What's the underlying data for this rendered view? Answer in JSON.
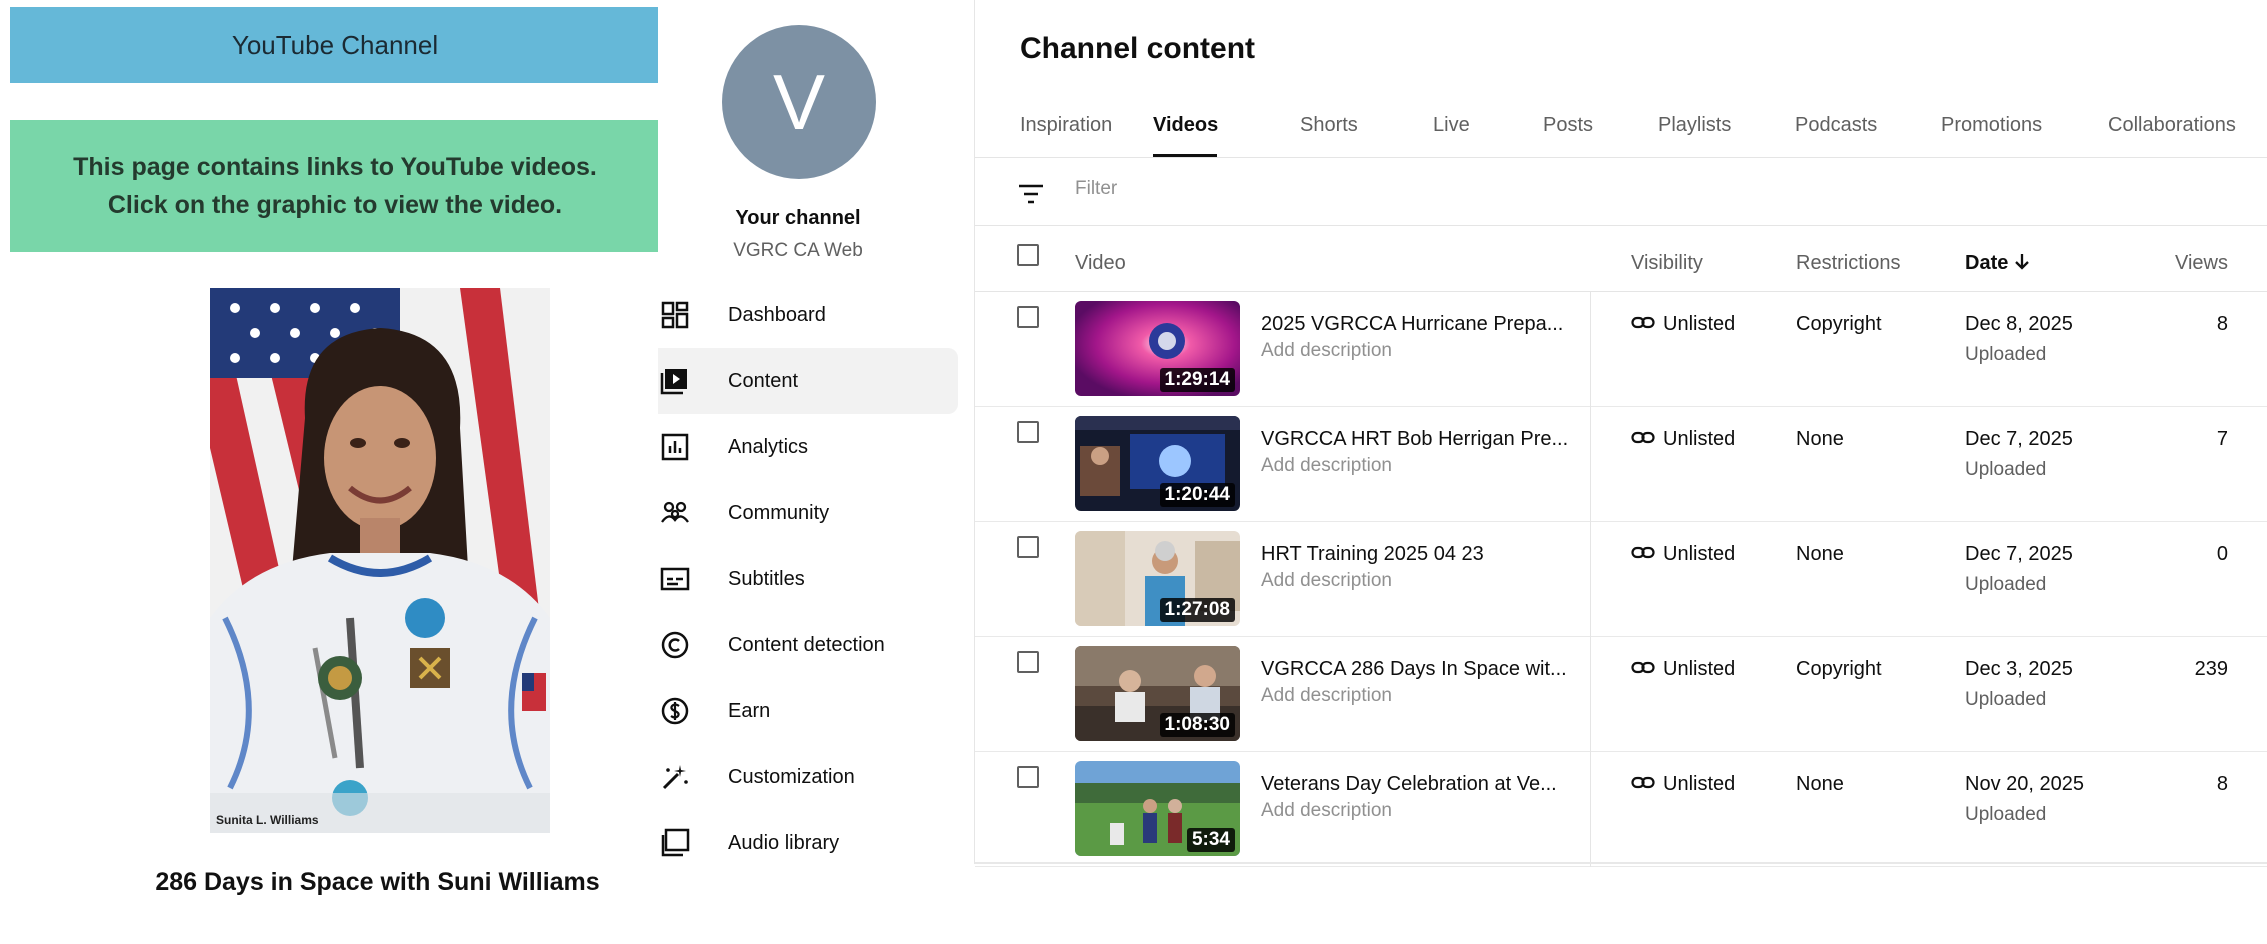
{
  "webpage": {
    "banner_title": "YouTube Channel",
    "notice_line1": "This page contains links to YouTube videos.",
    "notice_line2": "Click on the graphic to view the video.",
    "photo_caption": "Sunita L. Williams",
    "video_title": "286 Days in Space with Suni Williams"
  },
  "studio": {
    "channel": {
      "avatar_letter": "V",
      "label": "Your channel",
      "handle": "VGRC CA Web"
    },
    "nav": [
      {
        "label": "Dashboard",
        "icon": "dashboard-icon",
        "active": false
      },
      {
        "label": "Content",
        "icon": "content-icon",
        "active": true
      },
      {
        "label": "Analytics",
        "icon": "analytics-icon",
        "active": false
      },
      {
        "label": "Community",
        "icon": "community-icon",
        "active": false
      },
      {
        "label": "Subtitles",
        "icon": "subtitles-icon",
        "active": false
      },
      {
        "label": "Content detection",
        "icon": "copyright-icon",
        "active": false
      },
      {
        "label": "Earn",
        "icon": "dollar-icon",
        "active": false
      },
      {
        "label": "Customization",
        "icon": "magic-wand-icon",
        "active": false
      },
      {
        "label": "Audio library",
        "icon": "audio-library-icon",
        "active": false
      }
    ],
    "page_title": "Channel content",
    "tabs": [
      {
        "label": "Inspiration",
        "active": false
      },
      {
        "label": "Videos",
        "active": true
      },
      {
        "label": "Shorts",
        "active": false
      },
      {
        "label": "Live",
        "active": false
      },
      {
        "label": "Posts",
        "active": false
      },
      {
        "label": "Playlists",
        "active": false
      },
      {
        "label": "Podcasts",
        "active": false
      },
      {
        "label": "Promotions",
        "active": false
      },
      {
        "label": "Collaborations",
        "active": false
      }
    ],
    "filter": {
      "placeholder": "Filter",
      "icon": "filter-icon"
    },
    "columns": {
      "video": "Video",
      "visibility": "Visibility",
      "restrictions": "Restrictions",
      "date": "Date",
      "date_sort_icon": "arrow-down-icon",
      "views": "Views"
    },
    "videos": [
      {
        "title": "2025 VGRCCA Hurricane Prepa...",
        "description": "Add description",
        "duration": "1:29:14",
        "visibility": "Unlisted",
        "restrictions": "Copyright",
        "date": "Dec 8, 2025",
        "status": "Uploaded",
        "views": "8"
      },
      {
        "title": "VGRCCA HRT Bob Herrigan Pre...",
        "description": "Add description",
        "duration": "1:20:44",
        "visibility": "Unlisted",
        "restrictions": "None",
        "date": "Dec 7, 2025",
        "status": "Uploaded",
        "views": "7"
      },
      {
        "title": "HRT Training 2025 04 23",
        "description": "Add description",
        "duration": "1:27:08",
        "visibility": "Unlisted",
        "restrictions": "None",
        "date": "Dec 7, 2025",
        "status": "Uploaded",
        "views": "0"
      },
      {
        "title": "VGRCCA 286 Days In Space wit...",
        "description": "Add description",
        "duration": "1:08:30",
        "visibility": "Unlisted",
        "restrictions": "Copyright",
        "date": "Dec 3, 2025",
        "status": "Uploaded",
        "views": "239"
      },
      {
        "title": "Veterans Day Celebration at Ve...",
        "description": "Add description",
        "duration": "5:34",
        "visibility": "Unlisted",
        "restrictions": "None",
        "date": "Nov 20, 2025",
        "status": "Uploaded",
        "views": "8"
      }
    ]
  }
}
